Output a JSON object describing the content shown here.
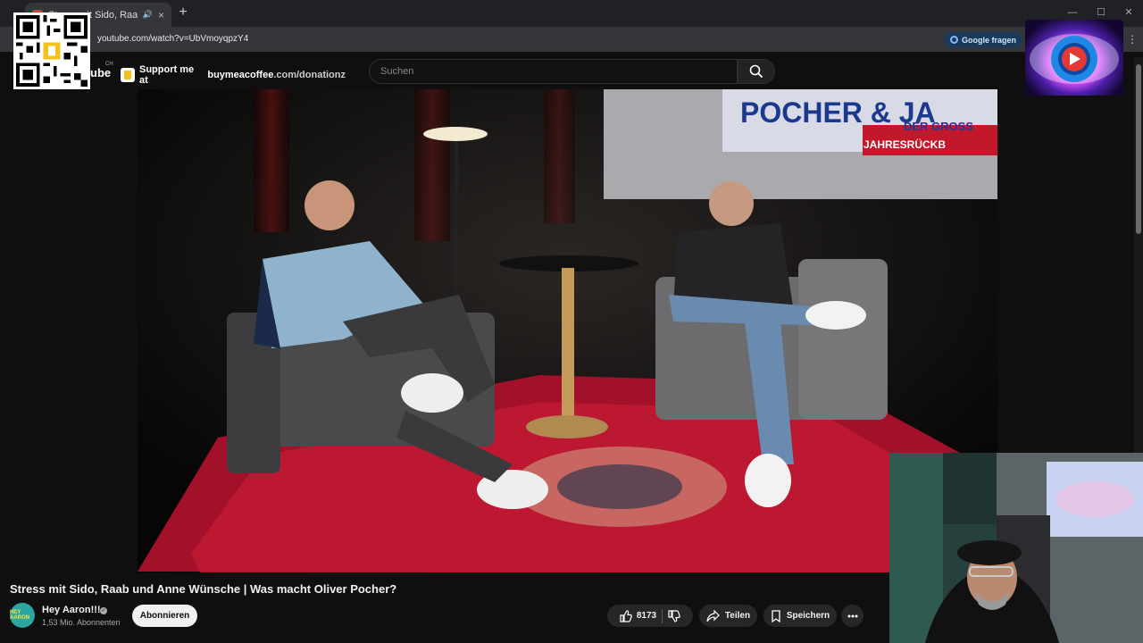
{
  "browser": {
    "tab_title": "Stress mit Sido, Raab und Anne Wünsche",
    "tab_close": "×",
    "new_tab": "+",
    "url": "youtube.com/watch?v=UbVmoyqpzY4",
    "google_button": "Google fragen",
    "window_controls": [
      "—",
      "☐",
      "✕"
    ]
  },
  "header": {
    "logo_text": "ube",
    "country": "CH",
    "support_prefix": "Support me at ",
    "support_domain": "buymeacoffee",
    "support_suffix": ".com/donationz",
    "search_placeholder": "Suchen"
  },
  "video": {
    "screen_text_1": "POCHER & JA",
    "screen_text_2": "DER GROSS",
    "screen_text_3": "JAHRESRÜCKB"
  },
  "info": {
    "title": "Stress mit Sido, Raab und Anne Wünsche | Was macht Oliver Pocher?",
    "channel_name": "Hey Aaron!!!",
    "avatar_text": "HEY AARON",
    "subscribers": "1,53 Mio. Abonnenten",
    "subscribe_label": "Abonnieren",
    "like_count": "8173",
    "share_label": "Teilen",
    "save_label": "Speichern"
  },
  "icons": {
    "search": "search-icon",
    "like": "thumbs-up-icon",
    "dislike": "thumbs-down-icon",
    "share": "share-arrow-icon",
    "save": "bookmark-icon",
    "more": "more-dots-icon",
    "verified": "verified-badge-icon"
  },
  "colors": {
    "yt_background": "#0f0f0f",
    "pill": "#272727",
    "rug_red": "#b3132a",
    "google_button_bg": "#1a3a5c"
  }
}
